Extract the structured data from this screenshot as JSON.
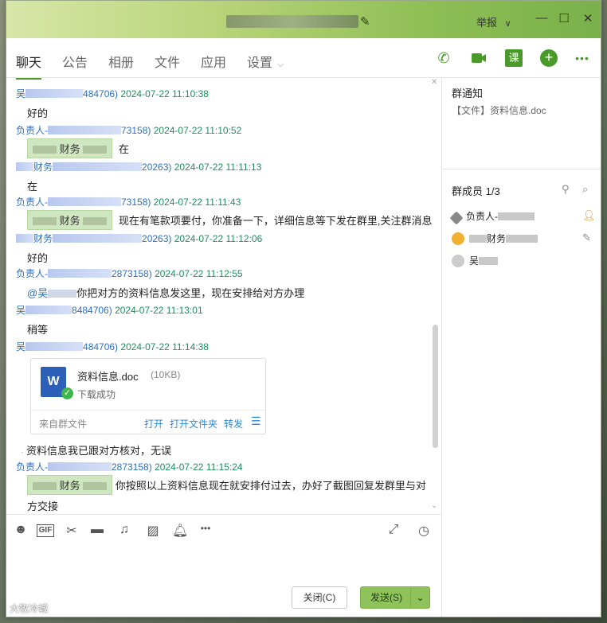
{
  "titlebar": {
    "report": "举报",
    "report_caret": "∨",
    "min": "—",
    "max": "☐",
    "close": "✕",
    "edit_icon": "pencil-icon"
  },
  "tabs": [
    {
      "label": "聊天"
    },
    {
      "label": "公告"
    },
    {
      "label": "相册"
    },
    {
      "label": "文件"
    },
    {
      "label": "应用"
    },
    {
      "label": "设置"
    }
  ],
  "toolbar_icons": [
    "phone-icon",
    "video-icon",
    "class-icon",
    "add-icon",
    "more-icon"
  ],
  "toolbar": {
    "class_label": "课",
    "more_label": "•••"
  },
  "messages": {
    "m1": {
      "name": "吴",
      "id_tail": "484706)",
      "time": "2024-07-22 11:10:38",
      "body": "好的"
    },
    "m2": {
      "name": "负责人-",
      "id_tail": "73158)",
      "time": "2024-07-22 11:10:52",
      "tag": "财务",
      "body": "在"
    },
    "m3": {
      "name": "财务",
      "id_tail": "20263)",
      "time": "2024-07-22 11:11:13",
      "body": "在"
    },
    "m4": {
      "name": "负责人-",
      "id_tail": "73158)",
      "time": "2024-07-22 11:11:43",
      "tag": "财务",
      "body": "现在有笔款项要付，你准备一下，详细信息等下发在群里,关注群消息"
    },
    "m5": {
      "name": "财务",
      "id_tail": "20263)",
      "time": "2024-07-22 11:12:06",
      "body": "好的"
    },
    "m6": {
      "name": "负责人-",
      "id_tail": "2873158)",
      "time": "2024-07-22 11:12:55",
      "at": "@吴",
      "body": "你把对方的资料信息发这里，现在安排给对方办理"
    },
    "m7": {
      "name": "吴",
      "id_tail": "8484706)",
      "time": "2024-07-22 11:13:01",
      "body": "稍等"
    },
    "m8": {
      "name": "吴",
      "id_tail": "484706)",
      "time": "2024-07-22 11:14:38"
    },
    "m9": {
      "body": "资料信息我已跟对方核对，无误"
    },
    "m10": {
      "name": "负责人-",
      "id_tail": "2873158)",
      "time": "2024-07-22 11:15:24",
      "tag": "财务",
      "body": "你按照以上资料信息现在就安排付过去，办好了截图回复发群里与对",
      "body2": "方交接"
    }
  },
  "file": {
    "name": "资料信息.doc",
    "size": "(10KB)",
    "status": "下载成功",
    "source": "来自群文件",
    "open": "打开",
    "open_folder": "打开文件夹",
    "forward": "转发",
    "doc_letter": "W"
  },
  "composer_icons": [
    "emoji-icon",
    "gif-icon",
    "scissors-icon",
    "folder-icon",
    "music-icon",
    "image-icon",
    "bell-icon",
    "more-icon"
  ],
  "composer": {
    "gif_label": "GIF"
  },
  "buttons": {
    "close": "关闭(C)",
    "send": "发送(S)"
  },
  "side": {
    "notice_title": "群通知",
    "notice_item": "【文件】资料信息.doc",
    "members_title": "群成员 1/3",
    "members": [
      {
        "name": "负责人-"
      },
      {
        "name": "财务"
      },
      {
        "name": "吴"
      }
    ]
  },
  "watermark": "大牧冷城"
}
